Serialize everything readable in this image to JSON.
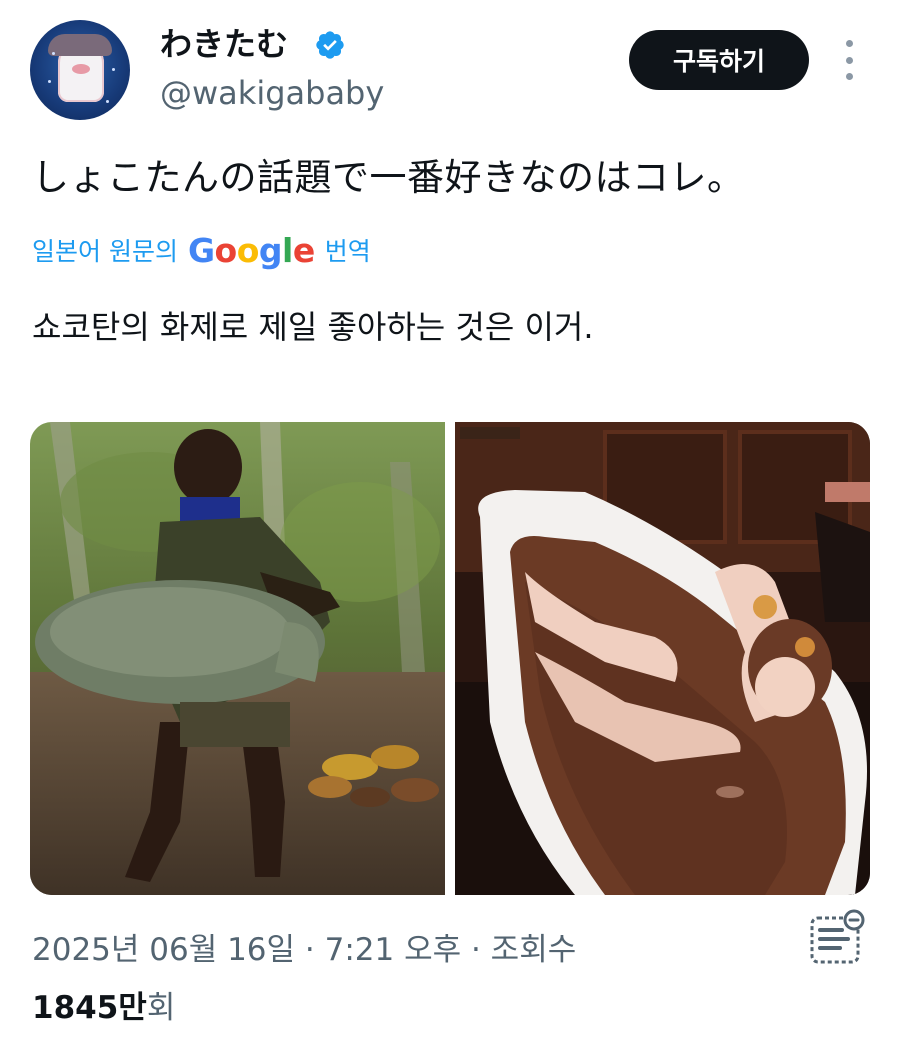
{
  "author": {
    "display_name": "わきたむ",
    "handle": "@wakigababy",
    "verified": true,
    "avatar_icon": "ghost-avatar-icon"
  },
  "actions": {
    "subscribe_label": "구독하기",
    "more_icon": "more-options-icon"
  },
  "tweet": {
    "text": "しょこたんの話題で一番好きなのはコレ。",
    "translation_prefix": "일본어 원문의",
    "translation_provider": "Google",
    "translation_suffix": "번역",
    "translated_text": "쇼코탄의 화제로 제일 좋아하는 것은 이거."
  },
  "media": {
    "count": 2,
    "photos": [
      "photo-cocoa-farm",
      "photo-chocolate-bath"
    ]
  },
  "meta": {
    "timestamp": "2025년 06월 16일 · 7:21 오후 · 조회수",
    "views_number": "1845만",
    "views_suffix": "회",
    "stats_icon": "analytics-icon"
  },
  "colors": {
    "accent": "#1d9bf0",
    "text": "#0f1419",
    "secondary": "#536471",
    "button_bg": "#0f1419"
  }
}
